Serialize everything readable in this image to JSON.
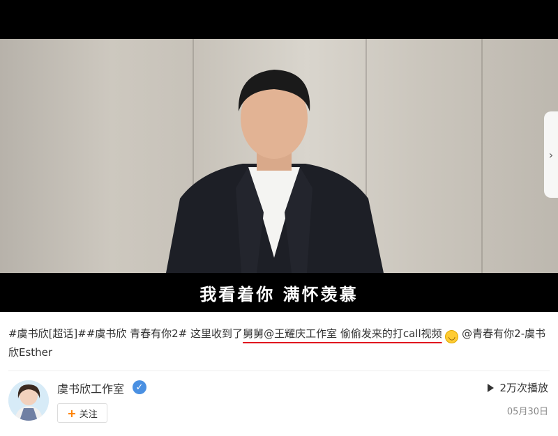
{
  "video": {
    "subtitle": "我看着你 满怀羡慕",
    "next_icon": "chevron-right-icon"
  },
  "post": {
    "segments": [
      "#虞书欣[超话]##虞书欣 青春有你2# 这里收到了",
      "舅舅@王耀庆工作室 偷偷发来的打call视频",
      " @青春有你2-虞书欣Esther"
    ],
    "emoji": "grin-emoji"
  },
  "author": {
    "name": "虞书欣工作室",
    "verified_icon": "verified-badge-icon",
    "follow_label": "关注"
  },
  "stats": {
    "play_count": "2万次播放",
    "date": "05月30日"
  },
  "colors": {
    "underline": "#e0141e",
    "verified": "#4a90e2",
    "follow_plus": "#ff8200"
  }
}
